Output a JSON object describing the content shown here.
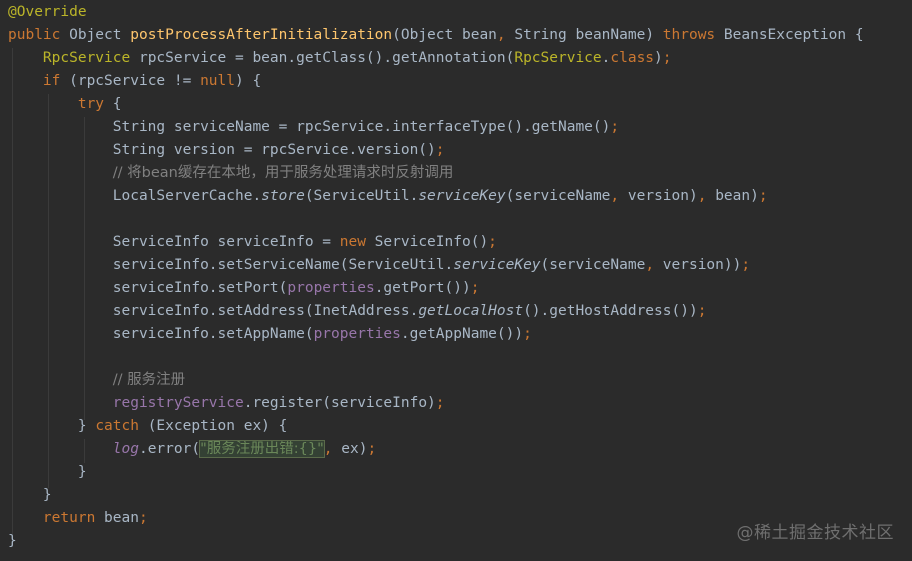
{
  "code": {
    "l1": {
      "a": "@Override"
    },
    "l2": {
      "a": "public",
      "b": " Object ",
      "c": "postProcessAfterInitialization",
      "d": "(Object bean",
      "e": ", ",
      "f": "String beanName) ",
      "g": "throws",
      "h": " BeansException {"
    },
    "l3": {
      "a": "RpcService",
      "b": " rpcService = bean.getClass().getAnnotation(",
      "c": "RpcService",
      "d": ".",
      "e": "class",
      "f": ")",
      "g": ";"
    },
    "l4": {
      "a": "if",
      "b": " (rpcService != ",
      "c": "null",
      "d": ") {"
    },
    "l5": {
      "a": "try",
      "b": " {"
    },
    "l6": {
      "a": "String serviceName = rpcService.interfaceType().getName()",
      "b": ";"
    },
    "l7": {
      "a": "String version = rpcService.version()",
      "b": ";"
    },
    "l8": {
      "a": "// 将bean缓存在本地，用于服务处理请求时反射调用"
    },
    "l9": {
      "a": "LocalServerCache.",
      "b": "store",
      "c": "(ServiceUtil.",
      "d": "serviceKey",
      "e": "(serviceName",
      "f": ", ",
      "g": "version)",
      "h": ", ",
      "i": "bean)",
      "j": ";"
    },
    "l10": {
      "a": "ServiceInfo serviceInfo = ",
      "b": "new",
      "c": " ServiceInfo()",
      "d": ";"
    },
    "l11": {
      "a": "serviceInfo.setServiceName(ServiceUtil.",
      "b": "serviceKey",
      "c": "(serviceName",
      "d": ", ",
      "e": "version))",
      "f": ";"
    },
    "l12": {
      "a": "serviceInfo.setPort(",
      "b": "properties",
      "c": ".getPort())",
      "d": ";"
    },
    "l13": {
      "a": "serviceInfo.setAddress(InetAddress.",
      "b": "getLocalHost",
      "c": "().getHostAddress())",
      "d": ";"
    },
    "l14": {
      "a": "serviceInfo.setAppName(",
      "b": "properties",
      "c": ".getAppName())",
      "d": ";"
    },
    "l15": {
      "a": "// 服务注册"
    },
    "l16": {
      "a": "registryService",
      "b": ".register(serviceInfo)",
      "c": ";"
    },
    "l17": {
      "a": "} ",
      "b": "catch",
      "c": " (Exception ex) {"
    },
    "l18": {
      "a": "log",
      "b": ".error(",
      "c": "\"服务注册出错:{}\"",
      "d": ", ",
      "e": "ex)",
      "f": ";"
    },
    "l19": {
      "a": "}"
    },
    "l20": {
      "a": "}"
    },
    "l21": {
      "a": "return",
      "b": " bean",
      "c": ";"
    },
    "l22": {
      "a": "}"
    }
  },
  "watermark": "@稀土掘金技术社区",
  "colors": {
    "background": "#2b2b2b",
    "default_text": "#a9b7c6",
    "keyword": "#cc7832",
    "annotation": "#bbb529",
    "method_declaration": "#ffc66d",
    "field": "#9876aa",
    "comment": "#808080",
    "string": "#6a8759"
  }
}
